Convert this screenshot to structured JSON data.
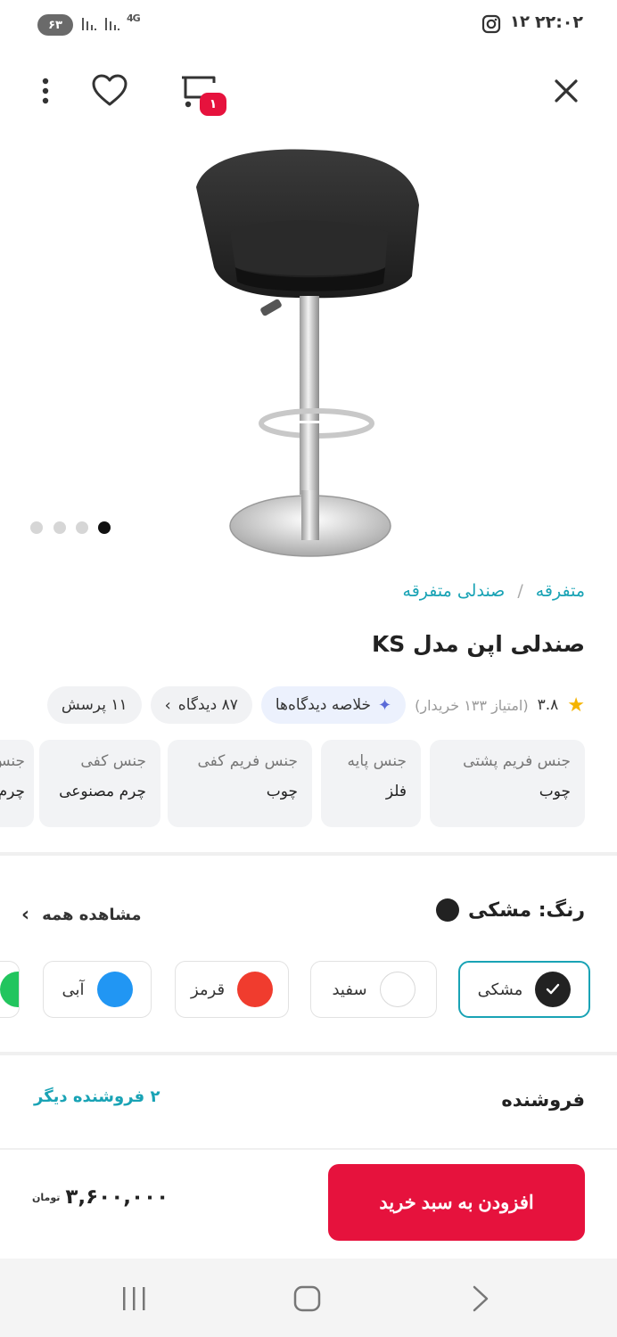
{
  "status_bar": {
    "time": "۲۲:۰۲",
    "notification_count": "۱۲",
    "battery": "۶۳",
    "network": "4G"
  },
  "top_bar": {
    "cart_count": "۱"
  },
  "gallery": {
    "dot_count": 4,
    "active_dot": 4
  },
  "breadcrumb": [
    "متفرقه",
    "صندلی متفرقه"
  ],
  "breadcrumb_separator": "/",
  "product": {
    "title": "صندلی اپن مدل KS",
    "rating": "۳.۸",
    "rating_sub": "(امتیاز ۱۳۳ خریدار)",
    "review_summary_label": "خلاصه دیدگاه‌ها",
    "reviews_label": "۸۷ دیدگاه",
    "questions_label": "۱۱ پرسش"
  },
  "specs": [
    {
      "key": "جنس فریم پشتی",
      "value": "چوب"
    },
    {
      "key": "جنس پایه",
      "value": "فلز"
    },
    {
      "key": "جنس فریم کفی",
      "value": "چوب"
    },
    {
      "key": "جنس کفی",
      "value": "چرم مصنوعی"
    },
    {
      "key": "جنس",
      "value": "چرم"
    }
  ],
  "color": {
    "title": "رنگ: مشکی",
    "see_all": "مشاهده همه",
    "options": [
      {
        "name": "مشکی",
        "hex": "#222222",
        "selected": true
      },
      {
        "name": "سفید",
        "hex": "#ffffff",
        "selected": false
      },
      {
        "name": "قرمز",
        "hex": "#f03c2e",
        "selected": false
      },
      {
        "name": "آبی",
        "hex": "#2196f3",
        "selected": false
      },
      {
        "name": "",
        "hex": "#22c55e",
        "selected": false
      }
    ]
  },
  "seller": {
    "label": "فروشنده",
    "other_sellers": "۲ فروشنده دیگر"
  },
  "purchase": {
    "price": "۳,۶۰۰,۰۰۰",
    "currency": "تومان",
    "add_to_cart": "افزودن به سبد خرید"
  },
  "colors": {
    "accent": "#19a3b5",
    "brand_red": "#e6123d",
    "star": "#f5b400"
  }
}
